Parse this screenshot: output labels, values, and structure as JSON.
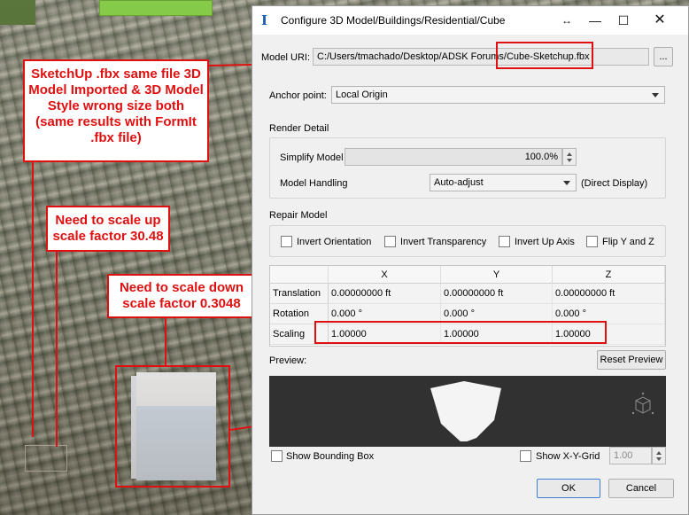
{
  "window": {
    "title": "Configure 3D Model/Buildings/Residential/Cube",
    "title_icon": "I"
  },
  "model_uri": {
    "label": "Model URI:",
    "value": "C:/Users/tmachado/Desktop/ADSK Forums/Cube-Sketchup.fbx",
    "browse_label": "..."
  },
  "anchor_point": {
    "label": "Anchor point:",
    "value": "Local Origin"
  },
  "render_detail": {
    "heading": "Render Detail",
    "simplify_label": "Simplify Model",
    "simplify_value": "100.0%",
    "handling_label": "Model Handling",
    "handling_value": "Auto-adjust",
    "handling_note": "(Direct Display)"
  },
  "repair_model": {
    "heading": "Repair Model",
    "options": [
      "Invert Orientation",
      "Invert Transparency",
      "Invert Up Axis",
      "Flip Y and Z"
    ]
  },
  "transform_table": {
    "columns": [
      "X",
      "Y",
      "Z"
    ],
    "rows": [
      {
        "label": "Translation",
        "values": [
          "0.00000000 ft",
          "0.00000000 ft",
          "0.00000000 ft"
        ]
      },
      {
        "label": "Rotation",
        "values": [
          "0.000 °",
          "0.000 °",
          "0.000 °"
        ]
      },
      {
        "label": "Scaling",
        "values": [
          "1.00000",
          "1.00000",
          "1.00000"
        ]
      }
    ]
  },
  "preview": {
    "label": "Preview:",
    "reset_label": "Reset Preview",
    "show_bounding_box": "Show Bounding Box",
    "show_grid": "Show X-Y-Grid",
    "grid_value": "1.00"
  },
  "footer": {
    "ok_label": "OK",
    "cancel_label": "Cancel"
  },
  "annotations": {
    "callout_1": "SketchUp .fbx same file 3D Model Imported & 3D Model Style wrong size both (same results with FormIt .fbx file)",
    "callout_2": "Need to scale up scale factor 30.48",
    "callout_3": "Need to scale down scale factor 0.3048",
    "color": "#e01010"
  }
}
